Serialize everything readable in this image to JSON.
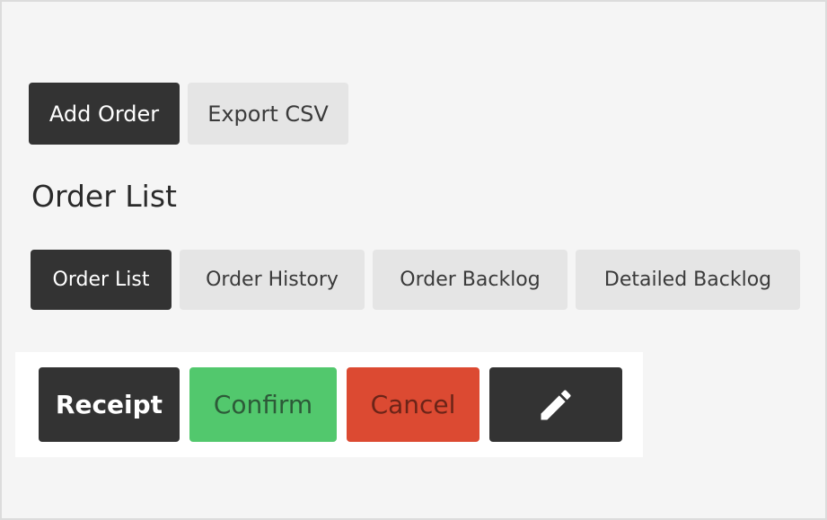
{
  "toolbar": {
    "add_order_label": "Add Order",
    "export_csv_label": "Export CSV"
  },
  "page": {
    "title": "Order List"
  },
  "tabs": [
    {
      "label": "Order List",
      "active": true
    },
    {
      "label": "Order History",
      "active": false
    },
    {
      "label": "Order Backlog",
      "active": false
    },
    {
      "label": "Detailed Backlog",
      "active": false
    }
  ],
  "actions": {
    "receipt_label": "Receipt",
    "confirm_label": "Confirm",
    "cancel_label": "Cancel",
    "edit_icon": "pencil-icon"
  },
  "colors": {
    "dark": "#333333",
    "light": "#e5e5e5",
    "confirm": "#52c86d",
    "cancel": "#dc4a32",
    "background": "#f5f5f5"
  }
}
